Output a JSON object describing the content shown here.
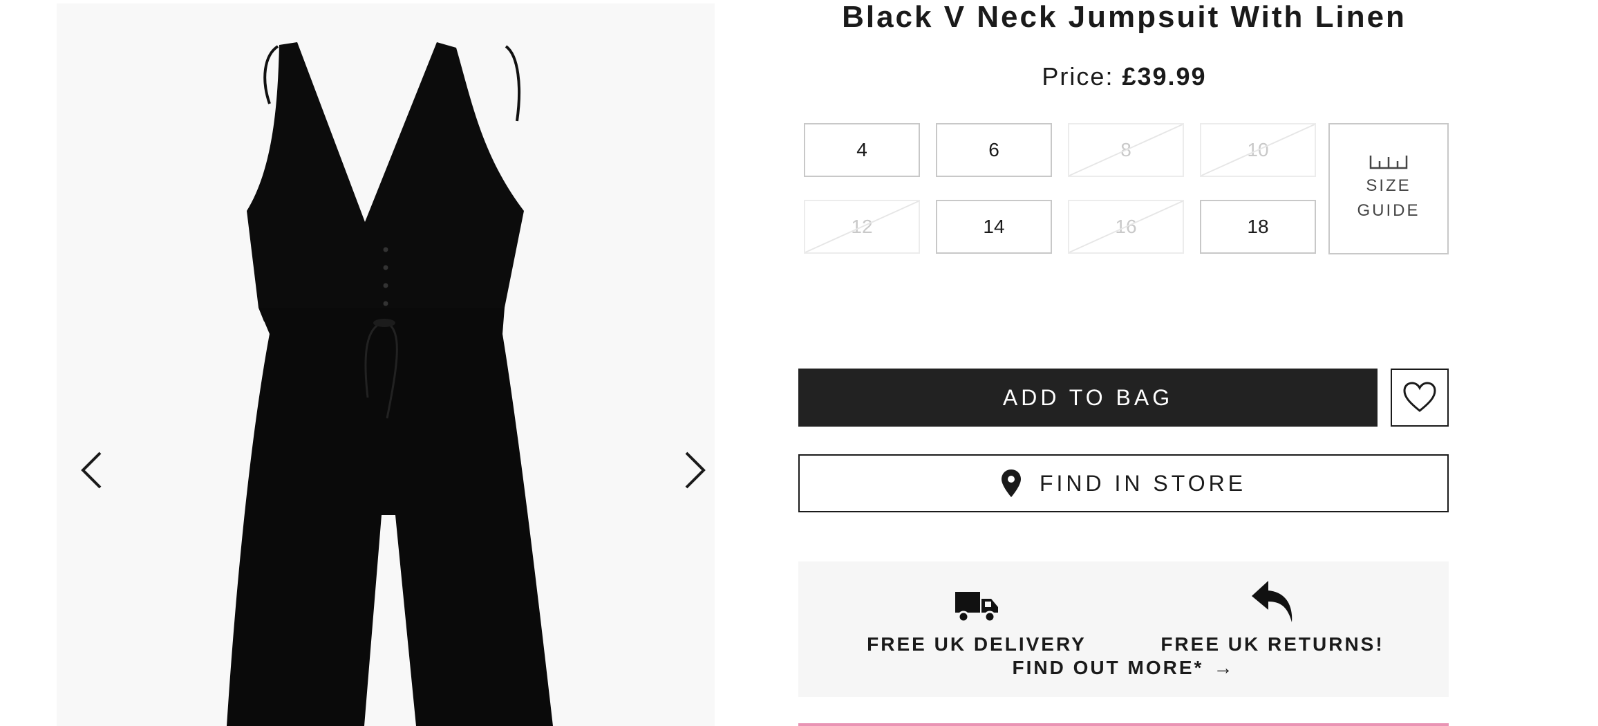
{
  "product": {
    "title": "Black V Neck Jumpsuit With Linen",
    "price_label": "Price:",
    "price_value": "£39.99"
  },
  "gallery": {
    "prev_icon": "chevron-left-icon",
    "next_icon": "chevron-right-icon"
  },
  "sizes": [
    {
      "label": "4",
      "available": true
    },
    {
      "label": "6",
      "available": true
    },
    {
      "label": "8",
      "available": false
    },
    {
      "label": "10",
      "available": false
    },
    {
      "label": "12",
      "available": false
    },
    {
      "label": "14",
      "available": true
    },
    {
      "label": "16",
      "available": false
    },
    {
      "label": "18",
      "available": true
    }
  ],
  "size_guide": {
    "line1": "SIZE",
    "line2": "GUIDE",
    "icon": "ruler-icon"
  },
  "actions": {
    "add_to_bag": "ADD TO BAG",
    "wishlist_icon": "heart-icon",
    "find_in_store": "FIND IN STORE",
    "find_in_store_icon": "location-pin-icon"
  },
  "info": {
    "delivery": "FREE UK DELIVERY",
    "delivery_icon": "truck-icon",
    "returns": "FREE UK RETURNS!",
    "returns_icon": "return-arrow-icon",
    "find_more": "FIND OUT MORE*",
    "find_more_arrow": "→"
  },
  "colors": {
    "primary_button": "#222222",
    "accent_rule": "#e994b4",
    "panel_bg": "#f6f6f6",
    "unavailable_text": "#c9c9c9"
  }
}
